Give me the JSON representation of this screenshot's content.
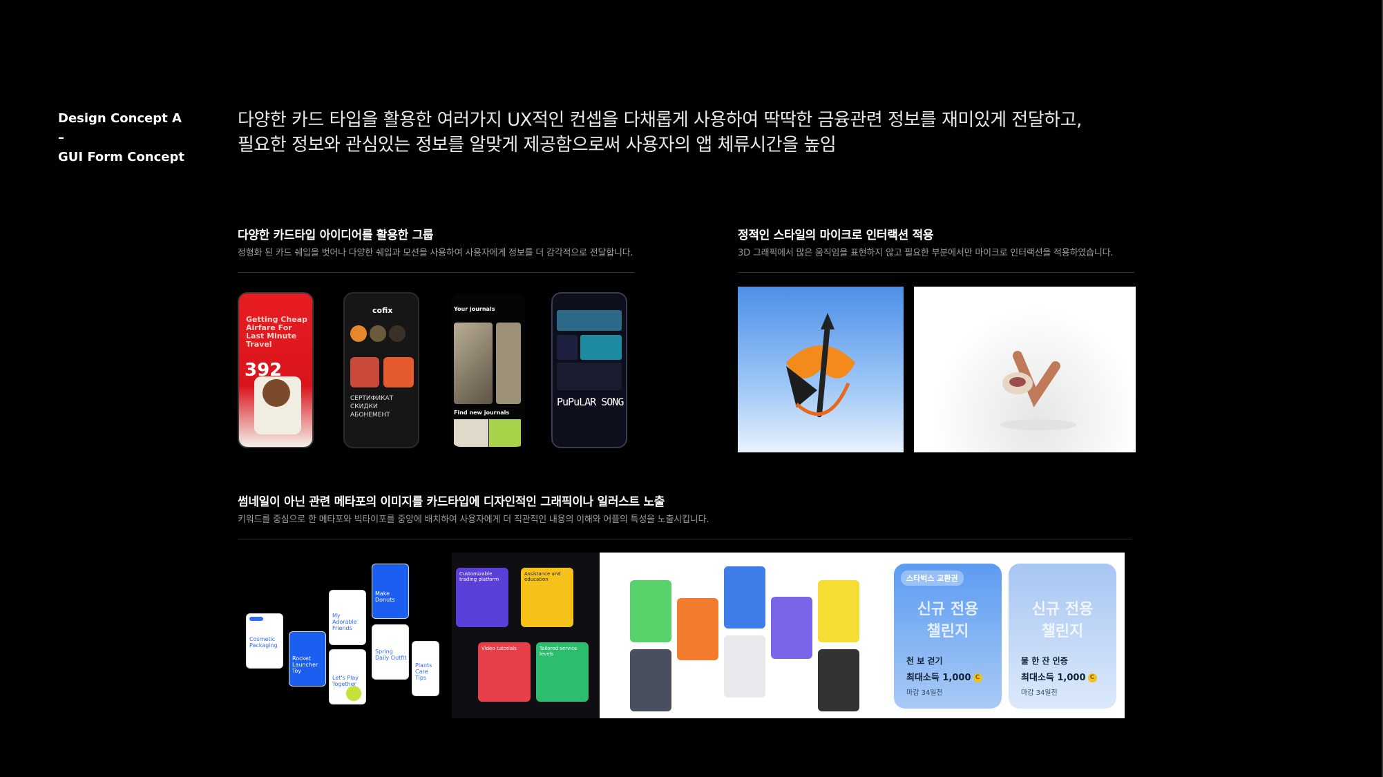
{
  "side": {
    "line1": "Design Concept  A",
    "line2": "–",
    "line3": "GUI Form Concept"
  },
  "headline": {
    "line1": "다양한 카드 타입을 활용한 여러가지 UX적인 컨셉을 다채롭게 사용하여 딱딱한 금융관련 정보를 재미있게 전달하고,",
    "line2": "필요한 정보와 관심있는 정보를 알맞게 제공함으로써 사용자의 앱 체류시간을 높임"
  },
  "section1": {
    "title": "다양한 카드타입 아이디어를 활용한 그룹",
    "desc": "정형화 된 카드 쉐입을 벗어나 다양한 쉐입과 모션을 사용하여 사용자에게 정보를 더 감각적으로 전달합니다."
  },
  "section2": {
    "title": "정적인 스타일의 마이크로 인터랙션 적용",
    "desc": "3D 그래픽에서 많은 움직임을 표현하지 않고 필요한 부분에서만 마이크로 인터랙션을 적용하였습니다."
  },
  "section3": {
    "title": "썸네일이 아닌 관련 메타포의 이미지를 카드타입에 디자인적인 그래픽이나 일러스트 노출",
    "desc": "키워드를 중심으로 한 메타포와 빅타이포를 중앙에 배치하여 사용자에게 더 직관적인 내용의 이해와 어플의 특성을 노출시킵니다."
  },
  "phones": {
    "p1_title": "Getting Cheap Airfare For Last Minute Travel",
    "p1_number": "392",
    "p2_logo": "cofix",
    "p2_text": "СЕРТИФИКАТ СКИДКИ АБОНЕМЕНТ",
    "p3_label": "Your journals",
    "p3_label2": "Find new journals",
    "p4_text": "PuPuLAR SONG"
  },
  "collage": {
    "mini_labels": [
      "Cosmetic Packaging",
      "Rocket Launcher Toy",
      "My Adorable Friends",
      "Let's Play Together",
      "Make Donuts",
      "Spring Daily Outfit",
      "Plants Care Tips"
    ],
    "c2_labels": [
      "Customizable trading platform",
      "Assistance and education",
      "Video tutorials",
      "Tailored service levels"
    ],
    "challenge1": {
      "badge": "스타벅스 교환권",
      "big1": "신규 전용",
      "big2": "챌린지",
      "line1": "천 보 걷기",
      "line2": "최대소득 1,000",
      "line3": "마감 34일전"
    },
    "challenge2": {
      "big1": "신규 전용",
      "big2": "챌린지",
      "line1": "물 한 잔 인증",
      "line2": "최대소득 1,000",
      "line3": "마감 34일전"
    },
    "coin_symbol": "C"
  },
  "colors": {
    "background": "#000000",
    "text": "#ffffff",
    "muted": "#9b9b9b",
    "accent_red": "#e81d23",
    "accent_blue": "#2f6bff"
  }
}
